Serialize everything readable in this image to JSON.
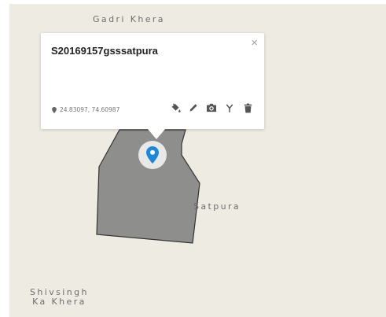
{
  "map": {
    "labels": {
      "gadri_khera": "Gadri Khera",
      "satpura": "Satpura",
      "shivsingh_line1": "Shivsingh",
      "shivsingh_line2": "Ka Khera"
    },
    "polygon_fill": "#8e8e8c",
    "polygon_stroke": "#333333",
    "marker_icon": "map-pin-icon",
    "marker_color": "#1e88d6",
    "background_color": "#eeebe2"
  },
  "popup": {
    "title": "S20169157gsssatpura",
    "close_label": "×",
    "coordinates_icon": "location-pin-icon",
    "coordinates": "24.83097, 74.60987",
    "actions": [
      {
        "name": "style-button",
        "icon": "paint-bucket-icon"
      },
      {
        "name": "edit-button",
        "icon": "pencil-icon"
      },
      {
        "name": "photo-button",
        "icon": "camera-icon"
      },
      {
        "name": "split-button",
        "icon": "fork-icon"
      },
      {
        "name": "delete-button",
        "icon": "trash-icon"
      }
    ]
  }
}
